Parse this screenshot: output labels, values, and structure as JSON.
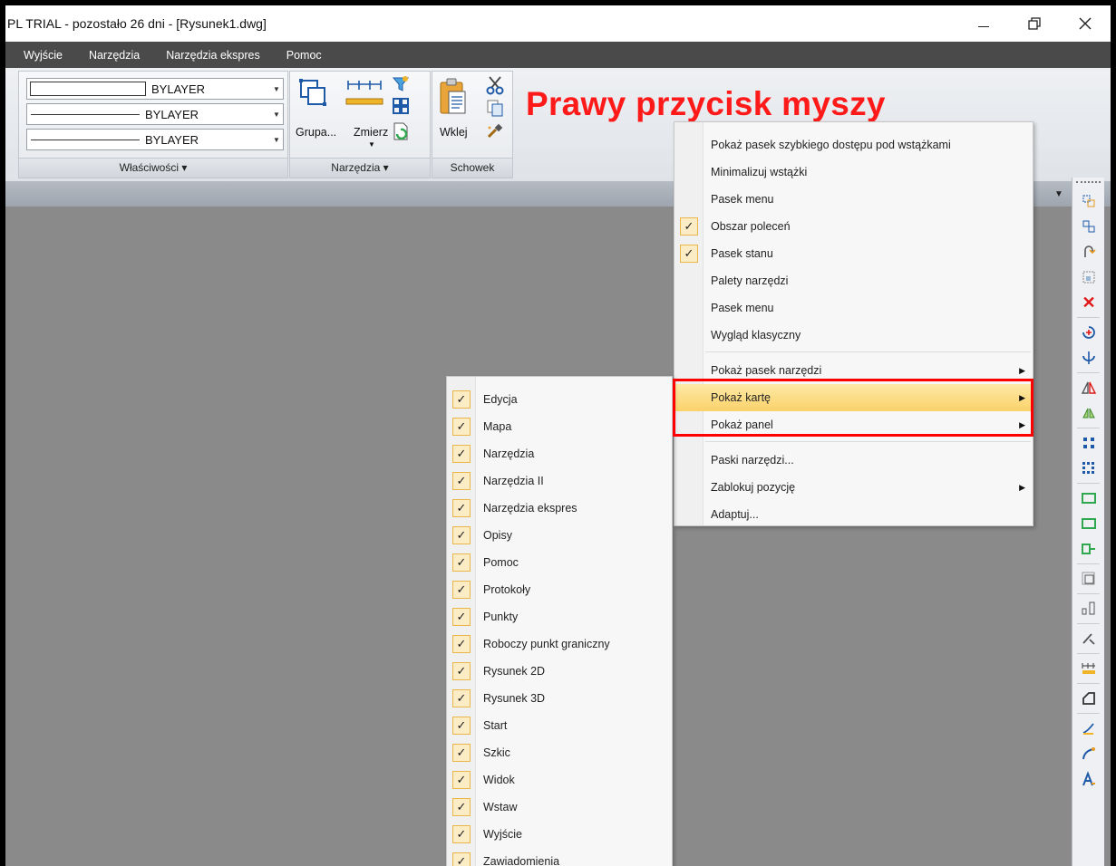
{
  "window": {
    "title": "PL TRIAL - pozostało 26 dni - [Rysunek1.dwg]",
    "controls": {
      "minimize": "—",
      "maximize": "🗗",
      "close": "✕"
    }
  },
  "menubar": [
    "Wyjście",
    "Narzędzia",
    "Narzędzia ekspres",
    "Pomoc"
  ],
  "ribbon": {
    "properties": {
      "title": "Właściwości ▾",
      "dropdowns": [
        "BYLAYER",
        "BYLAYER",
        "BYLAYER"
      ]
    },
    "tools": {
      "title": "Narzędzia ▾",
      "group_label": "Grupa...",
      "measure_label": "Zmierz"
    },
    "clipboard": {
      "title": "Schowek",
      "paste_label": "Wklej"
    }
  },
  "annotation": "Prawy przycisk myszy",
  "context_menu": {
    "items": [
      {
        "label": "Pokaż pasek szybkiego dostępu pod wstążkami",
        "checked": false,
        "submenu": false
      },
      {
        "label": "Minimalizuj wstążki",
        "checked": false,
        "submenu": false
      },
      {
        "label": "Pasek menu",
        "checked": false,
        "submenu": false
      },
      {
        "label": "Obszar poleceń",
        "checked": true,
        "submenu": false
      },
      {
        "label": "Pasek stanu",
        "checked": true,
        "submenu": false
      },
      {
        "label": "Palety narzędzi",
        "checked": false,
        "submenu": false
      },
      {
        "label": "Pasek menu",
        "checked": false,
        "submenu": false
      },
      {
        "label": "Wygląd klasyczny",
        "checked": false,
        "submenu": false
      },
      {
        "label": "Pokaż pasek narzędzi",
        "checked": false,
        "submenu": true
      },
      {
        "label": "Pokaż kartę",
        "checked": false,
        "submenu": true,
        "highlighted": true
      },
      {
        "label": "Pokaż panel",
        "checked": false,
        "submenu": true
      },
      {
        "label": "Paski narzędzi...",
        "checked": false,
        "submenu": false
      },
      {
        "label": "Zablokuj pozycję",
        "checked": false,
        "submenu": true
      },
      {
        "label": "Adaptuj...",
        "checked": false,
        "submenu": false
      }
    ]
  },
  "tabs_submenu": {
    "items": [
      "Edycja",
      "Mapa",
      "Narzędzia",
      "Narzędzia II",
      "Narzędzia ekspres",
      "Opisy",
      "Pomoc",
      "Protokoły",
      "Punkty",
      "Roboczy punkt graniczny",
      "Rysunek 2D",
      "Rysunek 3D",
      "Start",
      "Szkic",
      "Widok",
      "Wstaw",
      "Wyjście",
      "Zawiadomienia"
    ]
  },
  "checkmark": "✓",
  "submenu_arrow": "▶",
  "dropdown_arrow": "▼",
  "accent_color": "#ff0000",
  "menu_highlight_color": "#fbd26a"
}
